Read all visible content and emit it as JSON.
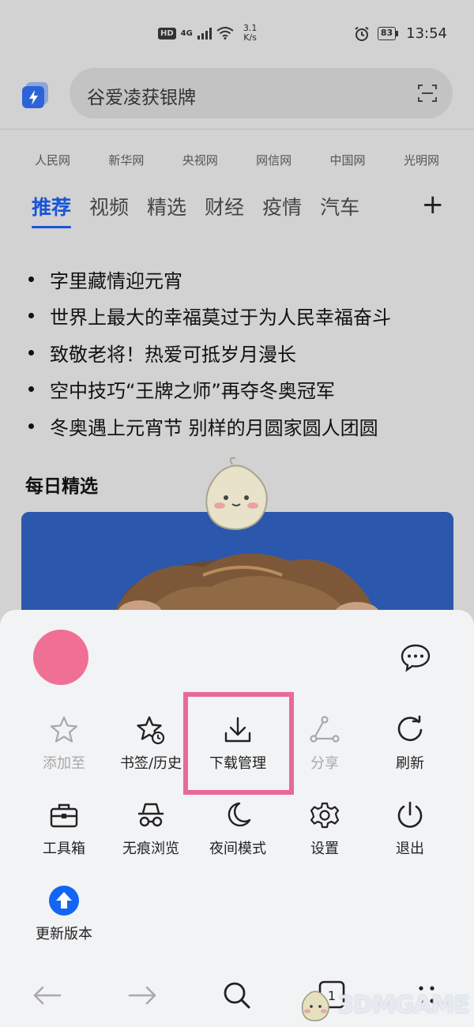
{
  "status_bar": {
    "hd": "HD",
    "network": "4G",
    "net_speed_value": "3.1",
    "net_speed_unit": "K/s",
    "battery": "83",
    "time": "13:54"
  },
  "search": {
    "query": "谷爱凌获银牌"
  },
  "quick_sites": [
    "人民网",
    "新华网",
    "央视网",
    "网信网",
    "中国网",
    "光明网"
  ],
  "tabs": [
    {
      "label": "推荐",
      "active": true
    },
    {
      "label": "视频",
      "active": false
    },
    {
      "label": "精选",
      "active": false
    },
    {
      "label": "财经",
      "active": false
    },
    {
      "label": "疫情",
      "active": false
    },
    {
      "label": "汽车",
      "active": false
    }
  ],
  "headlines": [
    "字里藏情迎元宵",
    "世界上最大的幸福莫过于为人民幸福奋斗",
    "致敬老将！热爱可抵岁月漫长",
    "空中技巧“王牌之师”再夺冬奥冠军",
    "冬奥遇上元宵节 别样的月圆家圆人团圆"
  ],
  "daily": {
    "title": "每日精选"
  },
  "menu": {
    "row1": [
      "添加至",
      "书签/历史",
      "下载管理",
      "分享",
      "刷新"
    ],
    "row2": [
      "工具箱",
      "无痕浏览",
      "夜间模式",
      "设置",
      "退出"
    ],
    "row3": [
      "更新版本"
    ]
  },
  "watermark": "3DMGAME",
  "colors": {
    "accent": "#1a55d6",
    "avatar": "#f06f95",
    "highlight": "#e8699a",
    "update": "#1565f5"
  }
}
